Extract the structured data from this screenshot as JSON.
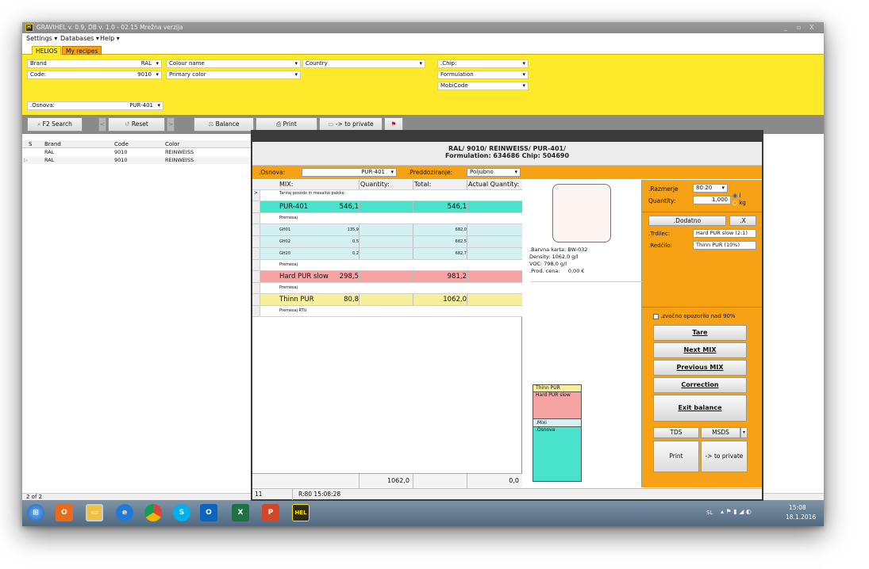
{
  "app": {
    "title": "GRAVIHEL v. 0.9, DB v. 1.0 - 02.15 Mrežna verzija",
    "logo_text": "HEL",
    "win_controls": [
      "_",
      "▫",
      "X"
    ]
  },
  "menu": {
    "items": [
      "Settings ▾",
      "Databases ▾",
      "Help ▾"
    ]
  },
  "tabs": [
    {
      "label": "HELIOS"
    },
    {
      "label": "My recipes"
    }
  ],
  "filters": {
    "brand_label": "Brand",
    "brand_value": "RAL",
    "code_label": "Code:",
    "code_value": "9010",
    "colour_name": "Colour name",
    "primary_color": "Primary color",
    "country": "Country",
    "chip": ".Chip:",
    "formulation": "Formulation",
    "mobicode": "MobiCode",
    "osnova_label": ".Osnova:",
    "osnova_value": "PUR-401"
  },
  "toolbar": {
    "search": "F2 Search",
    "left": "<",
    "reset": "Reset",
    "right": ">",
    "balance": "Balance",
    "print": "Print",
    "to_private": "-> to private"
  },
  "grid": {
    "headers": [
      "S",
      "Brand",
      "Code",
      "Color"
    ],
    "rows": [
      {
        "brand": "RAL",
        "code": "9010",
        "color": "REINWEISS"
      },
      {
        "brand": "RAL",
        "code": "9010",
        "color": "REINWEISS"
      }
    ],
    "footer": "2 of 2"
  },
  "balance": {
    "header_line1": "RAL/ 9010/ REINWEISS/ PUR-401/",
    "header_line2": "Formulation: 634686  Chip: 504690",
    "osnova_label": ".Osnova:",
    "osnova_value": "PUR-401",
    "predoz_label": ".Preddoziranje:",
    "predoz_value": "Poljubno",
    "table_headers": [
      "MIX:",
      "Quantity:",
      "Total:",
      "Actual Quantity:"
    ],
    "rows": [
      {
        "name": "Tariraj posodo in mesalno palcko"
      },
      {
        "name": "PUR-401",
        "qty": "546,1",
        "total": "546,1"
      },
      {
        "name": "Premesaj"
      },
      {
        "name": "GH01",
        "qty": "135,9",
        "total": "682,0"
      },
      {
        "name": "GH02",
        "qty": "0,5",
        "total": "682,5"
      },
      {
        "name": "GH20",
        "qty": "0,2",
        "total": "682,7"
      },
      {
        "name": "Premesaj"
      },
      {
        "name": "Hard PUR slow",
        "qty": "298,5",
        "total": "981,2"
      },
      {
        "name": "Premesaj"
      },
      {
        "name": "Thinn PUR",
        "qty": "80,8",
        "total": "1062,0"
      },
      {
        "name": "Premesaj RTU"
      }
    ],
    "footer_total": "1062,0",
    "footer_actual": "0,0",
    "info": {
      "barvna": ".Barvna karta: BW-032",
      "density": "Density: 1062,0 g/l",
      "voc": "VOC: 798,0 g/l",
      "prod_label": ".Prod. cena:",
      "prod_value": "0,00 €"
    },
    "stack": [
      "Thinn PUR",
      "Hard PUR slow",
      ".Mixi",
      ".Osnova"
    ],
    "right": {
      "razmerje_label": ".Razmerje",
      "razmerje_value": "80:20",
      "quantity_label": "Quantity:",
      "quantity_value": "1,000",
      "unit_l": "l",
      "unit_kg": "kg",
      "dodatno": ".Dodatno",
      "x": ".X",
      "trdilec_label": ".Trdilec:",
      "trdilec_value": "Hard PUR slow (2:1)",
      "redcilo_label": ".Redčilo:",
      "redcilo_value": "Thinn PUR (10%)",
      "zvocno": ".zvočno opozorilo nad 90%",
      "tare": "Tare",
      "next": "Next MIX",
      "previous": "Previous MIX",
      "correction": "Correction",
      "exit": "Exit balance",
      "tds": "TDS",
      "msds": "MSDS",
      "print": "Print",
      "to_private": "-> to private"
    },
    "status_left": "11",
    "status_right": "R:80 15:08:28"
  },
  "taskbar": {
    "lang": "SL",
    "time": "15:08",
    "date": "18.1.2016"
  }
}
